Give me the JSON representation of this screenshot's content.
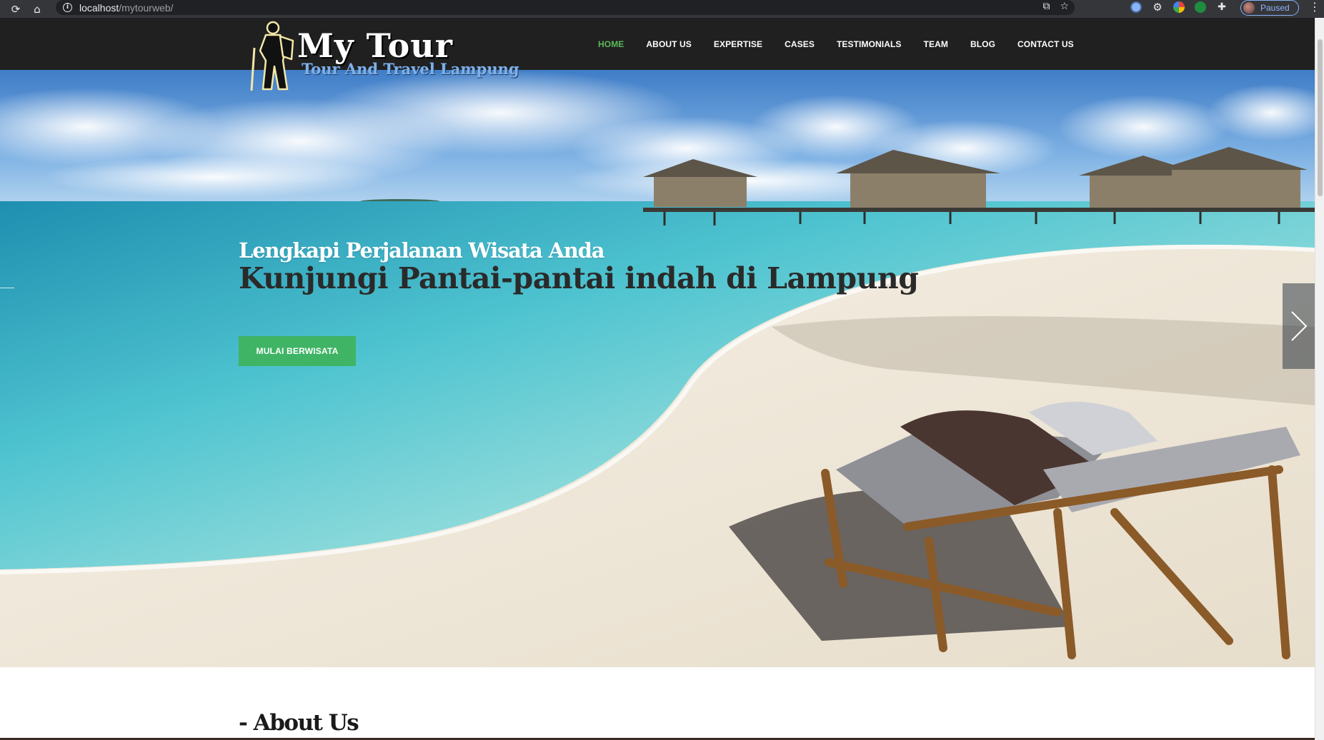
{
  "browser": {
    "url_host": "localhost",
    "url_path": "/mytourweb/",
    "profile_status": "Paused"
  },
  "header": {
    "logo_title": "My Tour",
    "logo_subtitle": "Tour And Travel Lampung",
    "nav": [
      {
        "label": "HOME",
        "active": true
      },
      {
        "label": "ABOUT US"
      },
      {
        "label": "EXPERTISE"
      },
      {
        "label": "CASES"
      },
      {
        "label": "TESTIMONIALS"
      },
      {
        "label": "TEAM"
      },
      {
        "label": "BLOG"
      },
      {
        "label": "CONTACT US"
      }
    ]
  },
  "hero": {
    "subtitle": "Lengkapi Perjalanan Wisata Anda",
    "title": "Kunjungi Pantai-pantai indah di Lampung",
    "cta_label": "MULAI BERWISATA"
  },
  "about": {
    "heading": "- About Us"
  },
  "colors": {
    "header_bg": "#202020",
    "accent_green": "#3fb465",
    "nav_active": "#5cb85c",
    "logo_blue": "#7fb0e6"
  },
  "icons": {
    "reload": "reload-icon",
    "home": "home-icon",
    "info": "info-icon",
    "share": "share-icon",
    "bookmark": "star-icon",
    "extensions": "puzzle-icon",
    "menu": "kebab-menu-icon",
    "slider_next": "chevron-right-icon",
    "slider_prev": "chevron-left-icon"
  }
}
